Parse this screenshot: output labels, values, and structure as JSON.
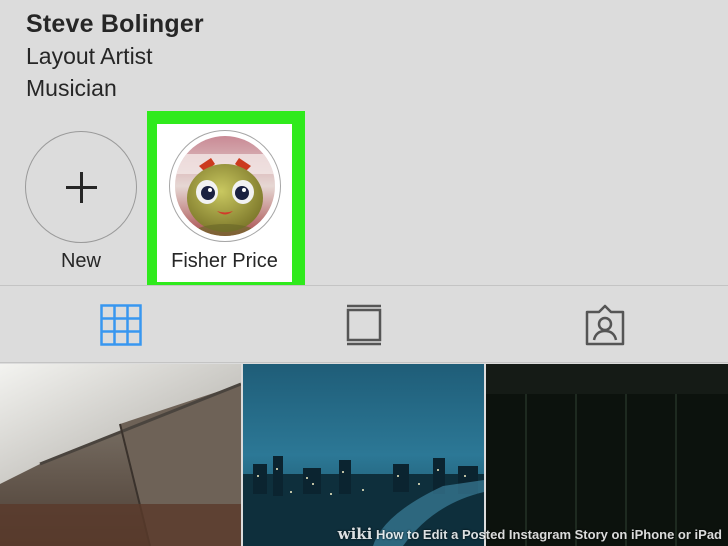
{
  "profile": {
    "name": "Steve Bolinger",
    "bio": [
      "Layout Artist",
      "Musician"
    ]
  },
  "highlights": {
    "new_label": "New",
    "items": [
      {
        "label": "Fisher Price"
      }
    ]
  },
  "tabs": [
    {
      "icon": "grid-icon",
      "active": true
    },
    {
      "icon": "feed-icon",
      "active": false
    },
    {
      "icon": "tagged-icon",
      "active": false
    }
  ],
  "colors": {
    "accent": "#3897f0",
    "highlight_frame": "#2fea1c",
    "background": "#dcdcdc"
  },
  "watermark": {
    "brand": "wiki",
    "text": "How to Edit a Posted Instagram Story on iPhone or iPad"
  }
}
